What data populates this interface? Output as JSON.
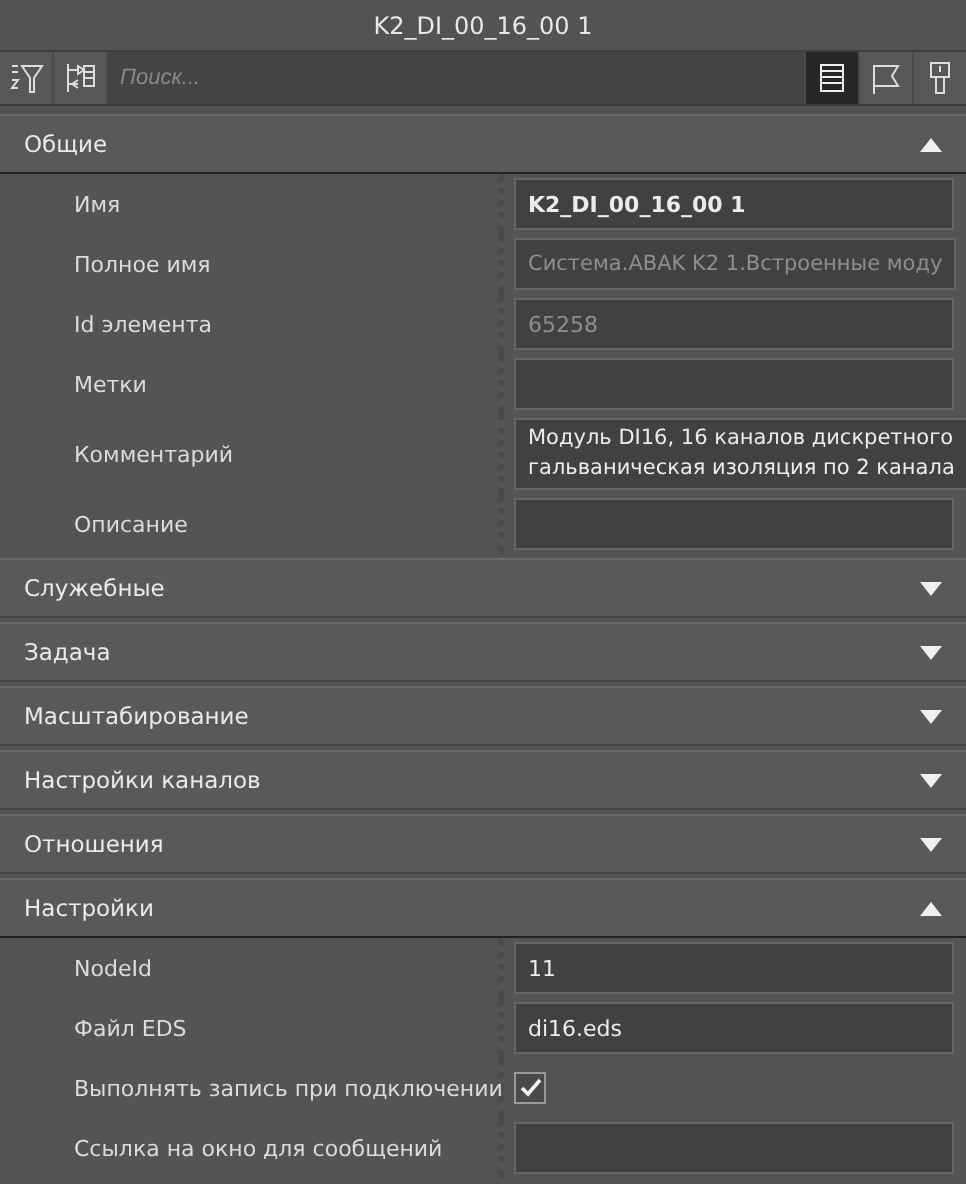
{
  "window": {
    "title": "K2_DI_00_16_00 1"
  },
  "toolbar": {
    "left_buttons": [
      {
        "selected": false
      },
      {
        "selected": false
      }
    ],
    "search": {
      "placeholder": "Поиск..."
    },
    "right_buttons": [
      {
        "selected": true
      },
      {
        "selected": false
      },
      {
        "selected": false
      }
    ]
  },
  "sections": [
    {
      "title": "Общие",
      "expanded": true,
      "rows": [
        {
          "label": "Имя",
          "kind": "text",
          "value": "K2_DI_00_16_00 1",
          "emphasized": true,
          "disabled": false
        },
        {
          "label": "Полное имя",
          "kind": "text",
          "value": "Система.ABAK K2 1.Встроенные моду",
          "emphasized": false,
          "disabled": true
        },
        {
          "label": "Id элемента",
          "kind": "text",
          "value": "65258",
          "emphasized": false,
          "disabled": true
        },
        {
          "label": "Метки",
          "kind": "text"
        },
        {
          "label": "Комментарий",
          "kind": "multiline",
          "lines": [
            "Модуль DI16, 16 каналов дискретного",
            "гальваническая изоляция по 2 канала"
          ]
        },
        {
          "label": "Описание",
          "kind": "text"
        }
      ]
    },
    {
      "title": "Служебные",
      "expanded": false
    },
    {
      "title": "Задача",
      "expanded": false
    },
    {
      "title": "Масштабирование",
      "expanded": false
    },
    {
      "title": "Настройки каналов",
      "expanded": false
    },
    {
      "title": "Отношения",
      "expanded": false
    },
    {
      "title": "Настройки",
      "expanded": true,
      "rows": [
        {
          "label": "NodeId",
          "kind": "text",
          "value": "11",
          "emphasized": false,
          "disabled": false
        },
        {
          "label": "Файл EDS",
          "kind": "text",
          "value": "di16.eds",
          "emphasized": false,
          "disabled": false
        },
        {
          "label": "Выполнять запись при подключении",
          "kind": "checkbox",
          "checked": true
        },
        {
          "label": "Ссылка на окно для сообщений",
          "kind": "text"
        }
      ]
    }
  ]
}
